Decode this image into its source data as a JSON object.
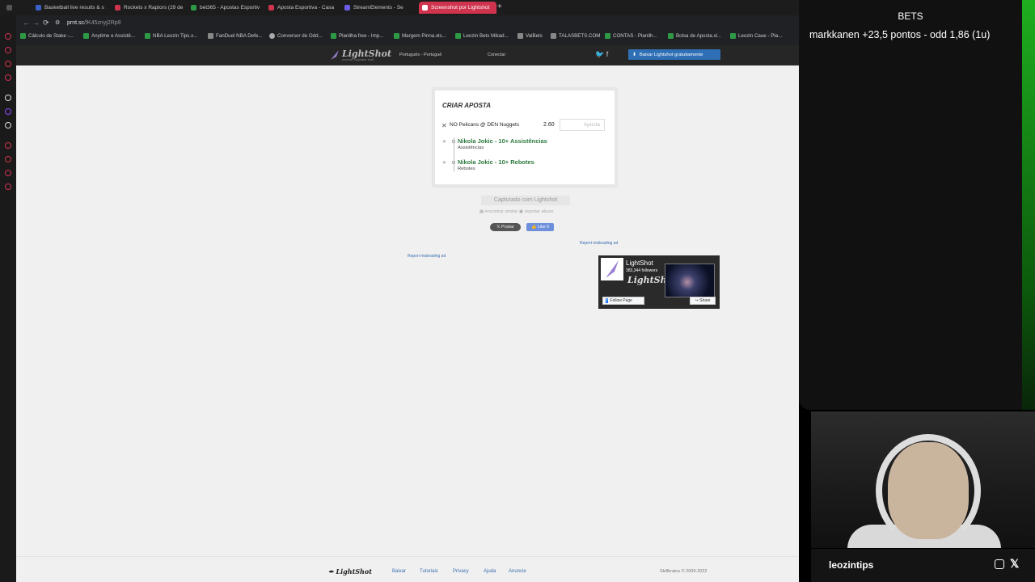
{
  "browser": {
    "tabs": [
      {
        "label": "Basketball live results & s"
      },
      {
        "label": "Rockets x Raptors (29 de"
      },
      {
        "label": "bet365 - Apostas Esportiv"
      },
      {
        "label": "Aposta Esportiva - Casa"
      },
      {
        "label": "StreamElements - Se"
      },
      {
        "label": "Screenshot por Lightshot"
      }
    ],
    "new_tab": "+",
    "url_host": "prnt.sc",
    "url_path": "/fK45znyj2Rp9",
    "bookmarks": [
      "Cálculo de Stake -...",
      "Anytime e Assistê...",
      "NBA Leozin Tips.x...",
      "FanDuel NBA Defe...",
      "Conversor de Odd...",
      "Planilha free - Imp...",
      "Margem Pinna.xls...",
      "Leozin Bets Mikad...",
      "ValBets",
      "TALASBETS.COM",
      "CONTAS - Planilh...",
      "Bolsa de Aposta.xl...",
      "Leozin Caue - Pla..."
    ]
  },
  "lightshot": {
    "logo": "LightShot",
    "logo_tag": "screen capture tool",
    "language": "Português - Portuguê",
    "login": "Conectar",
    "download_btn": "Baixar Lightshot gratuitamente",
    "card": {
      "title": "CRIAR APOSTA",
      "match": "NO Pelicans @ DEN Nuggets",
      "odd": "2.60",
      "stake_placeholder": "Aposta",
      "legs": [
        {
          "selection": "Nikola Jokic - 10+ Assistências",
          "market": "Assistências"
        },
        {
          "selection": "Nikola Jokic - 10+ Rebotes",
          "market": "Rebotes"
        }
      ]
    },
    "captured": "Capturado com Lightshot",
    "find_similar": "encontrar similar",
    "report_abuse": "reportar abuso",
    "post_btn": "Postar",
    "like_btn": "Like 0",
    "report_ad": "Report misleading ad",
    "fb": {
      "name": "LightShot",
      "followers": "383,344 followers",
      "follow": "Follow Page",
      "share": "Share"
    },
    "footer": {
      "logo": "LightShot",
      "links": [
        "Baixar",
        "Tutoriais",
        "Privacy",
        "Ajuda",
        "Anuncie"
      ],
      "copyright": "Skillbrains © 2009-2022"
    }
  },
  "overlay": {
    "title": "BETS",
    "bet_line": "markkanen +23,5 pontos - odd 1,86 (1u)"
  },
  "streamer": {
    "name": "leozintips"
  }
}
